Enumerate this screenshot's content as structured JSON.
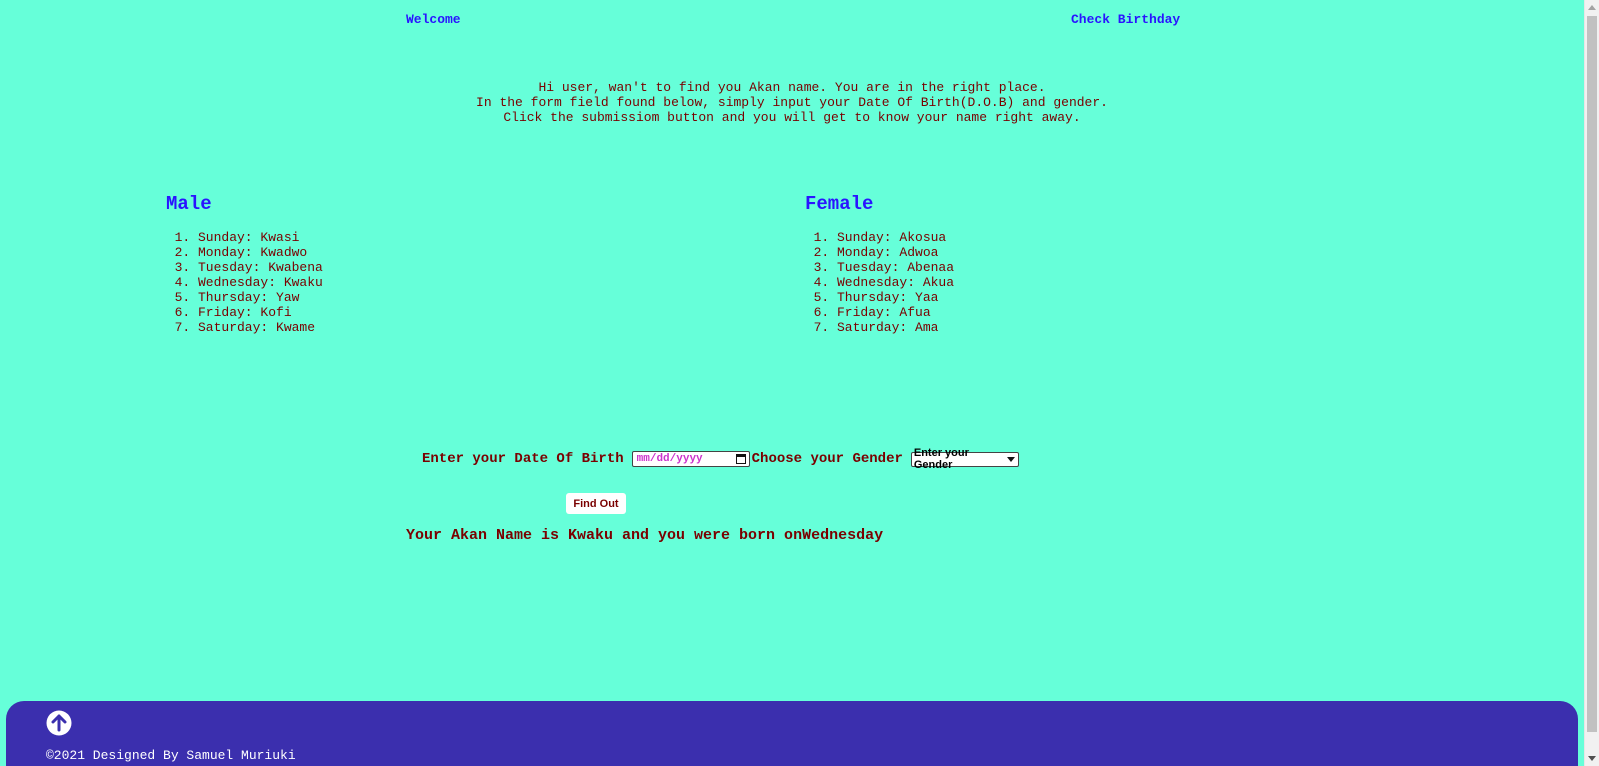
{
  "nav": {
    "welcome": "Welcome",
    "check_birthday": "Check Birthday"
  },
  "intro": {
    "line1": "Hi user, wan't to find you Akan name. You are in the right place.",
    "line2": "In the form field found below, simply input your Date Of Birth(D.O.B) and gender.",
    "line3": "Click the submissiom button and you will get to know your name right away."
  },
  "male": {
    "heading": "Male",
    "items": [
      "Sunday: Kwasi",
      "Monday: Kwadwo",
      "Tuesday: Kwabena",
      "Wednesday: Kwaku",
      "Thursday: Yaw",
      "Friday: Kofi",
      "Saturday: Kwame"
    ]
  },
  "female": {
    "heading": "Female",
    "items": [
      "Sunday: Akosua",
      "Monday: Adwoa",
      "Tuesday: Abenaa",
      "Wednesday: Akua",
      "Thursday: Yaa",
      "Friday: Afua",
      "Saturday: Ama"
    ]
  },
  "form": {
    "dob_label": "Enter your Date Of Birth",
    "dob_placeholder": "mm/dd/yyyy",
    "gender_label": "Choose your Gender",
    "gender_selected": "Enter your Gender",
    "submit_label": "Find Out"
  },
  "result": {
    "text": "Your Akan Name is Kwaku and you were born onWednesday"
  },
  "footer": {
    "copyright": "©2021 Designed By Samuel Muriuki",
    "up_icon": "arrow-up-circle-icon"
  },
  "colors": {
    "background": "#66ffd9",
    "link": "#2a14ff",
    "text": "#7a0000",
    "footer": "#3b2fae"
  }
}
